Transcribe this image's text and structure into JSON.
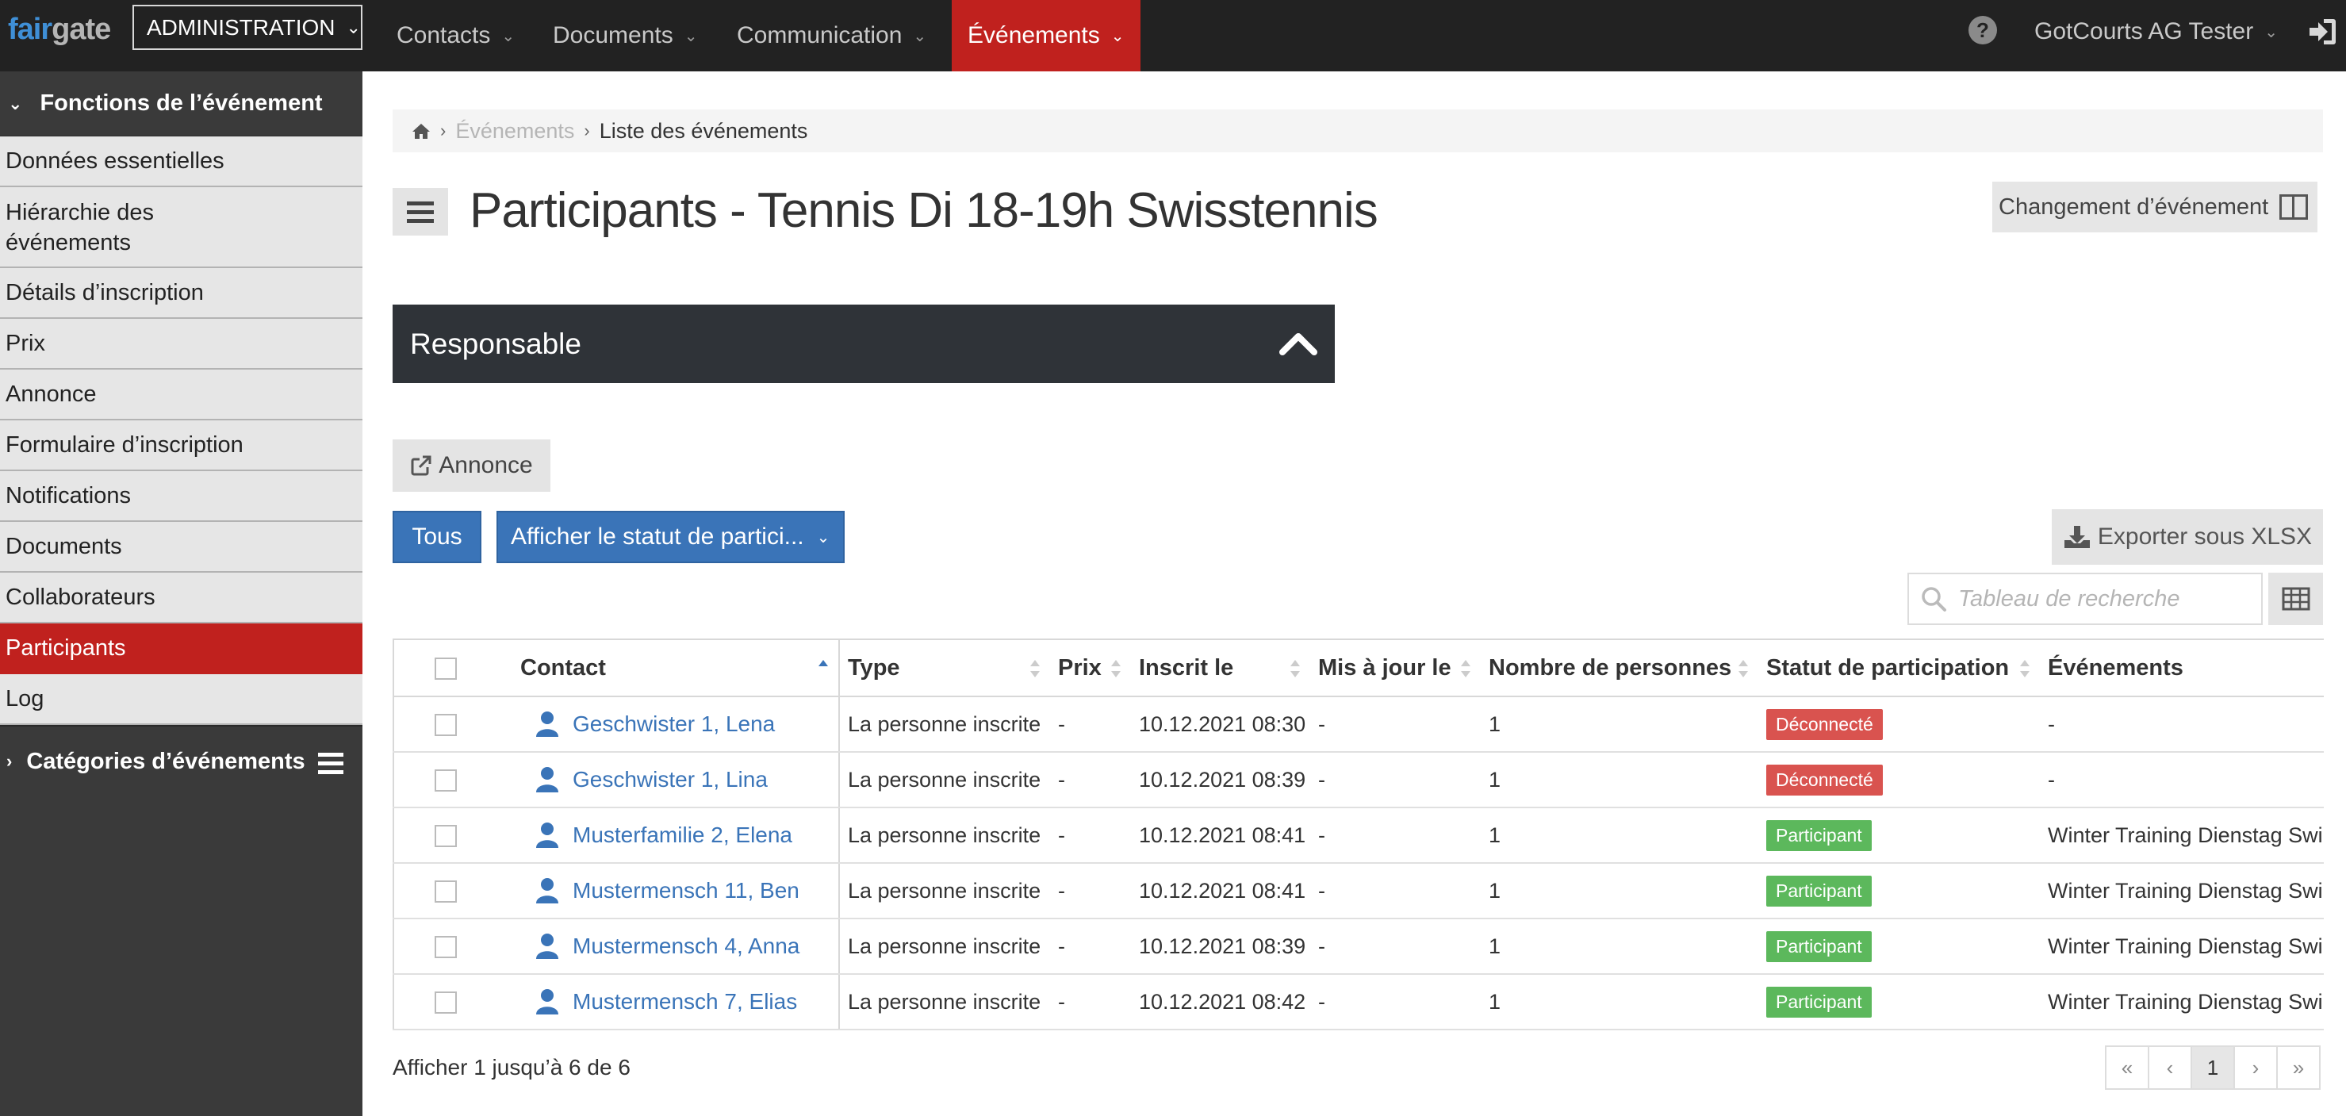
{
  "brand": {
    "part1": "fair",
    "part2": "gate"
  },
  "admin_menu": {
    "label": "ADMINISTRATION"
  },
  "nav": [
    {
      "label": "Contacts"
    },
    {
      "label": "Documents"
    },
    {
      "label": "Communication"
    },
    {
      "label": "Événements"
    }
  ],
  "user": {
    "name": "GotCourts AG Tester"
  },
  "sidebar": {
    "header": "Fonctions de l’événement",
    "items": [
      {
        "label": "Données essentielles"
      },
      {
        "label": "Hiérarchie des événements"
      },
      {
        "label": "Détails d’inscription"
      },
      {
        "label": "Prix"
      },
      {
        "label": "Annonce"
      },
      {
        "label": "Formulaire d’inscription"
      },
      {
        "label": "Notifications"
      },
      {
        "label": "Documents"
      },
      {
        "label": "Collaborateurs"
      },
      {
        "label": "Participants"
      },
      {
        "label": "Log"
      }
    ],
    "footer": "Catégories d’événements"
  },
  "breadcrumb": {
    "level1": "Événements",
    "level2": "Liste des événements"
  },
  "page": {
    "title": "Participants - Tennis Di 18-19h Swisstennis",
    "switch_label": "Changement d’événement"
  },
  "panel": {
    "title": "Responsable"
  },
  "annonce_label": "Annonce",
  "filters": {
    "all_label": "Tous",
    "status_label": "Afficher le statut de partici..."
  },
  "export_label": "Exporter sous XLSX",
  "search": {
    "placeholder": "Tableau de recherche"
  },
  "table": {
    "headers": {
      "contact": "Contact",
      "type": "Type",
      "prix": "Prix",
      "inscrit": "Inscrit le",
      "maj": "Mis à jour le",
      "nombre": "Nombre de personnes",
      "statut": "Statut de participation",
      "events": "Événements"
    },
    "rows": [
      {
        "contact": "Geschwister 1, Lena",
        "type": "La personne inscrite",
        "prix": "-",
        "inscrit": "10.12.2021 08:30",
        "maj": "-",
        "nombre": "1",
        "statut": "Déconnecté",
        "events": "-"
      },
      {
        "contact": "Geschwister 1, Lina",
        "type": "La personne inscrite",
        "prix": "-",
        "inscrit": "10.12.2021 08:39",
        "maj": "-",
        "nombre": "1",
        "statut": "Déconnecté",
        "events": "-"
      },
      {
        "contact": "Musterfamilie 2, Elena",
        "type": "La personne inscrite",
        "prix": "-",
        "inscrit": "10.12.2021 08:41",
        "maj": "-",
        "nombre": "1",
        "statut": "Participant",
        "events": "Winter Training Dienstag Swi"
      },
      {
        "contact": "Mustermensch 11, Ben",
        "type": "La personne inscrite",
        "prix": "-",
        "inscrit": "10.12.2021 08:41",
        "maj": "-",
        "nombre": "1",
        "statut": "Participant",
        "events": "Winter Training Dienstag Swi"
      },
      {
        "contact": "Mustermensch 4, Anna",
        "type": "La personne inscrite",
        "prix": "-",
        "inscrit": "10.12.2021 08:39",
        "maj": "-",
        "nombre": "1",
        "statut": "Participant",
        "events": "Winter Training Dienstag Swi"
      },
      {
        "contact": "Mustermensch 7, Elias",
        "type": "La personne inscrite",
        "prix": "-",
        "inscrit": "10.12.2021 08:42",
        "maj": "-",
        "nombre": "1",
        "statut": "Participant",
        "events": "Winter Training Dienstag Swi"
      }
    ]
  },
  "footer": {
    "info": "Afficher 1 jusqu’à 6 de 6",
    "pager": {
      "first": "«",
      "prev": "‹",
      "current": "1",
      "next": "›",
      "last": "»"
    }
  },
  "colors": {
    "accent_red": "#c0211e",
    "primary_blue": "#3a74b8",
    "badge_disconnected": "#d9534f",
    "badge_participant": "#5cb85c"
  }
}
